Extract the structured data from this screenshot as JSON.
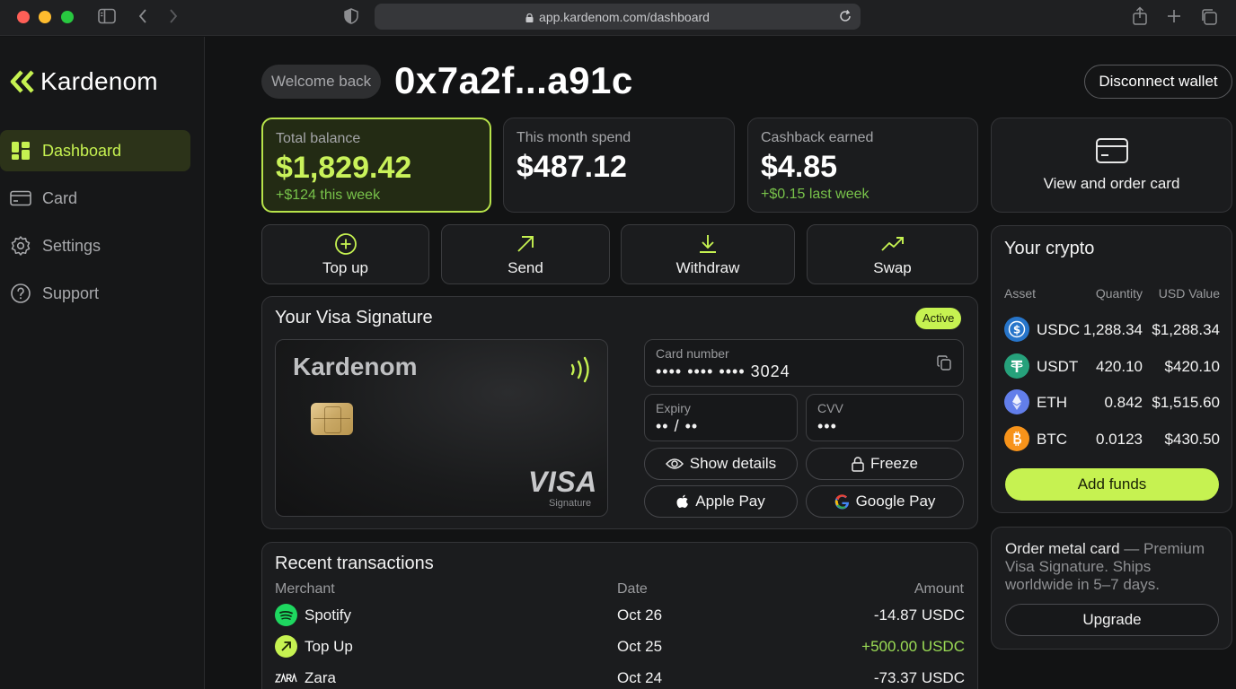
{
  "browser": {
    "url": "app.kardenom.com/dashboard"
  },
  "sidebar": {
    "brand": "Kardenom",
    "items": [
      {
        "label": "Dashboard",
        "icon": "grid-icon",
        "active": true
      },
      {
        "label": "Card",
        "icon": "card-icon",
        "active": false
      },
      {
        "label": "Settings",
        "icon": "gear-icon",
        "active": false
      },
      {
        "label": "Support",
        "icon": "help-icon",
        "active": false
      }
    ]
  },
  "header": {
    "welcome": "Welcome back",
    "wallet_address": "0x7a2f...a91c",
    "disconnect_label": "Disconnect wallet"
  },
  "stats": [
    {
      "label": "Total balance",
      "value": "$1,829.42",
      "sub": "+$124 this week"
    },
    {
      "label": "This month spend",
      "value": "$487.12",
      "sub": ""
    },
    {
      "label": "Cashback earned",
      "value": "$4.85",
      "sub": "+$0.15 last week"
    }
  ],
  "view_card": {
    "label": "View and order card"
  },
  "actions": [
    {
      "label": "Top up",
      "icon": "plus-circle-icon"
    },
    {
      "label": "Send",
      "icon": "arrow-up-right-icon"
    },
    {
      "label": "Withdraw",
      "icon": "download-icon"
    },
    {
      "label": "Swap",
      "icon": "trend-icon"
    }
  ],
  "visa_section": {
    "title": "Your Visa Signature",
    "status": "Active",
    "card_brand": "Kardenom",
    "network": "VISA",
    "tier": "Signature",
    "card_number_label": "Card number",
    "card_number": "•••• •••• •••• 3024",
    "expiry_label": "Expiry",
    "expiry": "•• / ••",
    "cvv_label": "CVV",
    "cvv": "•••",
    "show_details": "Show details",
    "freeze": "Freeze",
    "apple_pay": "Apple Pay",
    "google_pay": "Google Pay"
  },
  "transactions": {
    "title": "Recent transactions",
    "columns": [
      "Merchant",
      "Date",
      "Amount"
    ],
    "rows": [
      {
        "merchant": "Spotify",
        "date": "Oct 26",
        "amount": "-14.87 USDC",
        "icon": "spotify-icon",
        "positive": false
      },
      {
        "merchant": "Top Up",
        "date": "Oct 25",
        "amount": "+500.00 USDC",
        "icon": "topup-arrow-icon",
        "positive": true
      },
      {
        "merchant": "Zara",
        "date": "Oct 24",
        "amount": "-73.37 USDC",
        "icon": "zara-logo-icon",
        "positive": false
      }
    ]
  },
  "crypto": {
    "title": "Your crypto",
    "columns": [
      "Asset",
      "Quantity",
      "USD Value"
    ],
    "assets": [
      {
        "symbol": "USDC",
        "quantity": "1,288.34",
        "usd": "$1,288.34",
        "color": "#2775ca"
      },
      {
        "symbol": "USDT",
        "quantity": "420.10",
        "usd": "$420.10",
        "color": "#26a17b"
      },
      {
        "symbol": "ETH",
        "quantity": "0.842",
        "usd": "$1,515.60",
        "color": "#627eea"
      },
      {
        "symbol": "BTC",
        "quantity": "0.0123",
        "usd": "$430.50",
        "color": "#f7931a"
      }
    ],
    "add_funds": "Add funds"
  },
  "metal_card": {
    "title": "Order metal card",
    "description": " — Premium Visa Signature. Ships worldwide in 5–7 days.",
    "button": "Upgrade"
  },
  "colors": {
    "accent": "#c6f251",
    "background": "#121314",
    "panel": "#1b1c1e",
    "positive": "#9bdc55"
  }
}
